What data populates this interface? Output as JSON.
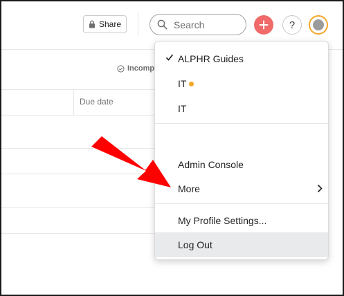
{
  "topbar": {
    "share_label": "Share",
    "search_placeholder": "Search"
  },
  "table": {
    "incomplete_label": "Incomp",
    "due_date_header": "Due date"
  },
  "menu": {
    "workspaces": [
      {
        "label": "ALPHR Guides",
        "checked": true
      },
      {
        "label": "IT",
        "notification_dot": true
      },
      {
        "label": "IT"
      }
    ],
    "admin_console": "Admin Console",
    "more": "More",
    "profile_settings": "My Profile Settings...",
    "log_out": "Log Out"
  },
  "colors": {
    "accent_plus": "#f06a6a",
    "avatar_ring": "#f4a72a",
    "notification_dot": "#f4a72a",
    "annotation_arrow": "#ff0000"
  }
}
